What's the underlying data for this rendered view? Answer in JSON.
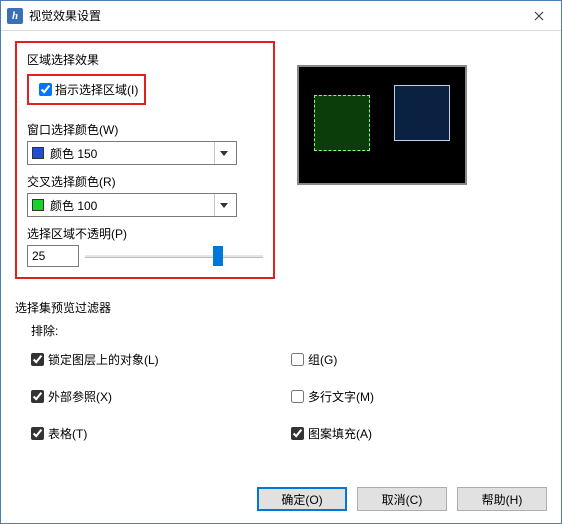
{
  "window": {
    "title": "视觉效果设置"
  },
  "area": {
    "title": "区域选择效果",
    "indicate_label": "指示选择区域(I)",
    "window_color_label": "窗口选择颜色(W)",
    "window_color_value": "颜色 150",
    "window_color_swatch": "#1e4fd6",
    "crossing_color_label": "交叉选择颜色(R)",
    "crossing_color_value": "颜色 100",
    "crossing_color_swatch": "#17d22a",
    "opacity_label": "选择区域不透明(P)",
    "opacity_value": "25"
  },
  "filter": {
    "title": "选择集预览过滤器",
    "exclude_label": "排除:",
    "locked_label": "锁定图层上的对象(L)",
    "xref_label": "外部参照(X)",
    "table_label": "表格(T)",
    "group_label": "组(G)",
    "mtext_label": "多行文字(M)",
    "hatch_label": "图案填充(A)"
  },
  "buttons": {
    "ok": "确定(O)",
    "cancel": "取消(C)",
    "help": "帮助(H)"
  }
}
